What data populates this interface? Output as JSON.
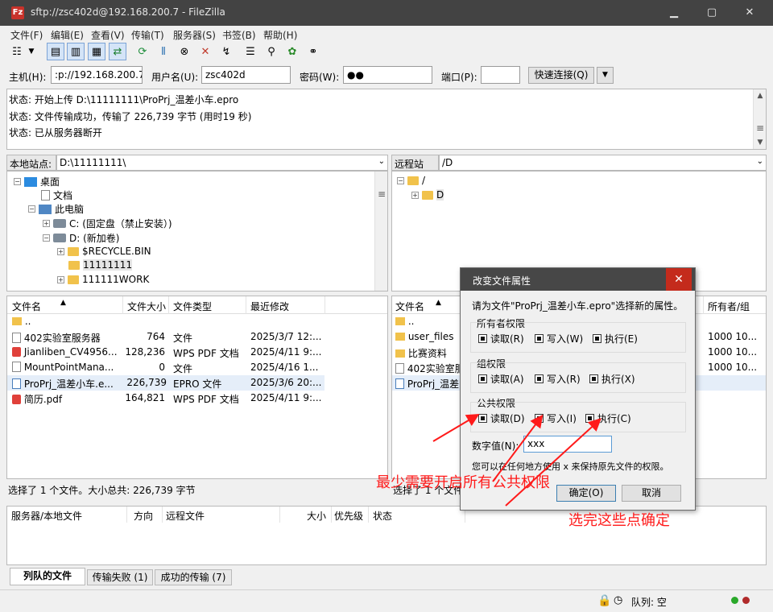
{
  "window": {
    "title": "sftp://zsc402d@192.168.200.7 - FileZilla",
    "app_icon": "Fz"
  },
  "menu": [
    "文件(F)",
    "编辑(E)",
    "查看(V)",
    "传输(T)",
    "服务器(S)",
    "书签(B)",
    "帮助(H)"
  ],
  "quickconnect": {
    "host_label": "主机(H):",
    "host_value": ":p://192.168.200.7",
    "user_label": "用户名(U):",
    "user_value": "zsc402d",
    "pass_label": "密码(W):",
    "pass_value": "●●",
    "port_label": "端口(P):",
    "port_value": "",
    "connect_label": "快速连接(Q)"
  },
  "log": [
    "状态: 开始上传 D:\\11111111\\ProPrj_温差小车.epro",
    "状态: 文件传输成功，传输了 226,739 字节 (用时19 秒)",
    "状态: 已从服务器断开"
  ],
  "local": {
    "site_label": "本地站点:",
    "path": "D:\\11111111\\",
    "tree": [
      {
        "label": "桌面",
        "icon": "desktop-icon"
      },
      {
        "label": "文档",
        "icon": "document-icon"
      },
      {
        "label": "此电脑",
        "icon": "computer-icon"
      },
      {
        "label": "C: (固定盘（禁止安装）)",
        "icon": "drive-icon"
      },
      {
        "label": "D: (新加卷)",
        "icon": "drive-icon"
      },
      {
        "label": "$RECYCLE.BIN",
        "icon": "folder-icon"
      },
      {
        "label": "11111111",
        "icon": "folder-icon"
      },
      {
        "label": "111111WORK",
        "icon": "folder-icon"
      }
    ],
    "columns": [
      "文件名",
      "文件大小",
      "文件类型",
      "最近修改"
    ],
    "files": [
      {
        "name": "..",
        "size": "",
        "type": "",
        "modified": ""
      },
      {
        "name": "402实验室服务器",
        "size": "764",
        "type": "文件",
        "modified": "2025/3/7 12:..."
      },
      {
        "name": "Jianliben_CV4956...",
        "size": "128,236",
        "type": "WPS PDF 文档",
        "modified": "2025/4/11 9:..."
      },
      {
        "name": "MountPointMana...",
        "size": "0",
        "type": "文件",
        "modified": "2025/4/16 1..."
      },
      {
        "name": "ProPrj_温差小车.e...",
        "size": "226,739",
        "type": "EPRO 文件",
        "modified": "2025/3/6 20:..."
      },
      {
        "name": "简历.pdf",
        "size": "164,821",
        "type": "WPS PDF 文档",
        "modified": "2025/4/11 9:..."
      }
    ],
    "status": "选择了 1 个文件。大小总共: 226,739 字节"
  },
  "remote": {
    "site_label": "远程站点:",
    "path": "/D",
    "tree": [
      {
        "label": "/"
      },
      {
        "label": "D"
      }
    ],
    "columns": [
      "文件名",
      "所有者/组"
    ],
    "files": [
      {
        "name": "..",
        "owner": ""
      },
      {
        "name": "user_files",
        "owner": "1000 10..."
      },
      {
        "name": "比赛资料",
        "owner": "1000 10..."
      },
      {
        "name": "402实验室服",
        "owner": "1000 10..."
      },
      {
        "name": "ProPrj_温差",
        "owner": ""
      }
    ],
    "status": "选择了 1 个文件"
  },
  "queue": {
    "columns": [
      "服务器/本地文件",
      "方向",
      "远程文件",
      "大小",
      "优先级",
      "状态"
    ],
    "tabs": [
      "列队的文件",
      "传输失败 (1)",
      "成功的传输 (7)"
    ],
    "queue_status": "队列: 空"
  },
  "dialog": {
    "title": "改变文件属性",
    "prompt": "请为文件\"ProPrj_温差小车.epro\"选择新的属性。",
    "groups": [
      {
        "title": "所有者权限",
        "read": "读取(R)",
        "write": "写入(W)",
        "exec": "执行(E)"
      },
      {
        "title": "组权限",
        "read": "读取(A)",
        "write": "写入(R)",
        "exec": "执行(X)"
      },
      {
        "title": "公共权限",
        "read": "读取(D)",
        "write": "写入(I)",
        "exec": "执行(C)"
      }
    ],
    "numeric_label": "数字值(N):",
    "numeric_value": "xxx",
    "hint": "您可以在任何地方使用 x 来保持原先文件的权限。",
    "ok": "确定(O)",
    "cancel": "取消"
  },
  "annotations": {
    "note1": "最少需要开启所有公共权限",
    "note2": "选完这些点确定",
    "color": "#ff1a1a"
  }
}
